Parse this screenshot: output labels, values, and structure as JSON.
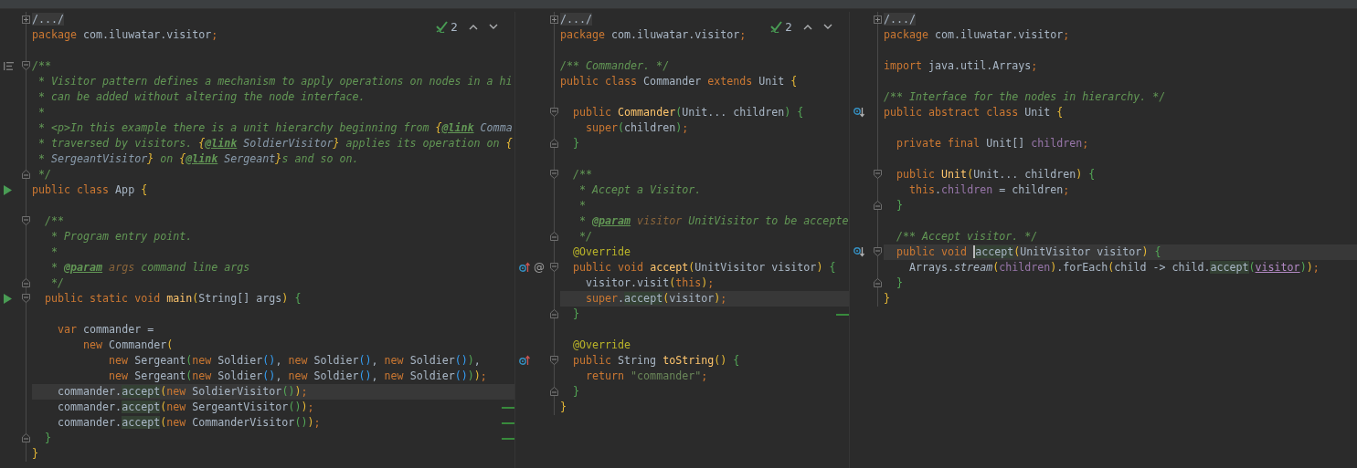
{
  "panes": [
    {
      "inspection": {
        "count": "2"
      },
      "lines": [
        {
          "kind": "code",
          "fold": {
            "kind": "plus"
          },
          "current": false,
          "changed": false,
          "tokens": [
            {
              "kind": "folded",
              "text": "/.../"
            }
          ]
        },
        {
          "kind": "code",
          "current": false,
          "changed": false,
          "tokens": [
            {
              "kind": "kw",
              "text": "package "
            },
            {
              "kind": "plain",
              "text": "com.iluwatar.visitor"
            },
            {
              "kind": "kw",
              "text": ";"
            }
          ]
        },
        {
          "kind": "blank"
        },
        {
          "kind": "code",
          "marker": {
            "kind": "docs"
          },
          "fold": {
            "kind": "open"
          },
          "current": false,
          "changed": false,
          "tokens": [
            {
              "kind": "comment",
              "text": "/**"
            }
          ]
        },
        {
          "kind": "code",
          "current": false,
          "changed": false,
          "tokens": [
            {
              "kind": "comment",
              "text": " * Visitor pattern defines a mechanism to apply operations on nodes in a hi"
            }
          ]
        },
        {
          "kind": "code",
          "current": false,
          "changed": false,
          "tokens": [
            {
              "kind": "comment",
              "text": " * can be added without altering the node interface."
            }
          ]
        },
        {
          "kind": "code",
          "current": false,
          "changed": false,
          "tokens": [
            {
              "kind": "comment",
              "text": " *"
            }
          ]
        },
        {
          "kind": "code",
          "current": false,
          "changed": false,
          "tokens": [
            {
              "kind": "comment",
              "text": " * <p>In this example there is a unit hierarchy beginning from "
            },
            {
              "kind": "docbrace",
              "text": "{"
            },
            {
              "kind": "doctag",
              "text": "@link"
            },
            {
              "kind": "docref",
              "text": " Comma"
            }
          ]
        },
        {
          "kind": "code",
          "current": false,
          "changed": false,
          "tokens": [
            {
              "kind": "comment",
              "text": " * traversed by visitors. "
            },
            {
              "kind": "docbrace",
              "text": "{"
            },
            {
              "kind": "doctag",
              "text": "@link"
            },
            {
              "kind": "docref",
              "text": " SoldierVisitor"
            },
            {
              "kind": "docbrace",
              "text": "}"
            },
            {
              "kind": "comment",
              "text": " applies its operation on "
            },
            {
              "kind": "docbrace",
              "text": "{"
            }
          ]
        },
        {
          "kind": "code",
          "current": false,
          "changed": false,
          "tokens": [
            {
              "kind": "comment",
              "text": " * "
            },
            {
              "kind": "docref",
              "text": "SergeantVisitor"
            },
            {
              "kind": "docbrace",
              "text": "}"
            },
            {
              "kind": "comment",
              "text": " on "
            },
            {
              "kind": "docbrace",
              "text": "{"
            },
            {
              "kind": "doctag",
              "text": "@link"
            },
            {
              "kind": "docref",
              "text": " Sergeant"
            },
            {
              "kind": "docbrace",
              "text": "}"
            },
            {
              "kind": "comment",
              "text": "s and so on."
            }
          ]
        },
        {
          "kind": "code",
          "fold": {
            "kind": "close"
          },
          "current": false,
          "changed": false,
          "tokens": [
            {
              "kind": "comment",
              "text": " */"
            }
          ]
        },
        {
          "kind": "code",
          "marker": {
            "kind": "run"
          },
          "current": false,
          "changed": false,
          "tokens": [
            {
              "kind": "kw",
              "text": "public class "
            },
            {
              "kind": "plain",
              "text": "App "
            },
            {
              "kind": "b1",
              "text": "{"
            }
          ]
        },
        {
          "kind": "blank"
        },
        {
          "kind": "code",
          "fold": {
            "kind": "open"
          },
          "current": false,
          "changed": false,
          "tokens": [
            {
              "kind": "comment",
              "text": "  /**"
            }
          ]
        },
        {
          "kind": "code",
          "current": false,
          "changed": false,
          "tokens": [
            {
              "kind": "comment",
              "text": "   * Program entry point."
            }
          ]
        },
        {
          "kind": "code",
          "current": false,
          "changed": false,
          "tokens": [
            {
              "kind": "comment",
              "text": "   *"
            }
          ]
        },
        {
          "kind": "code",
          "current": false,
          "changed": false,
          "tokens": [
            {
              "kind": "comment",
              "text": "   * "
            },
            {
              "kind": "doctag",
              "text": "@param"
            },
            {
              "kind": "docparam",
              "text": " args"
            },
            {
              "kind": "comment",
              "text": " command line args"
            }
          ]
        },
        {
          "kind": "code",
          "fold": {
            "kind": "close"
          },
          "current": false,
          "changed": false,
          "tokens": [
            {
              "kind": "comment",
              "text": "   */"
            }
          ]
        },
        {
          "kind": "code",
          "marker": {
            "kind": "run"
          },
          "fold": {
            "kind": "open"
          },
          "current": false,
          "changed": false,
          "tokens": [
            {
              "kind": "kw",
              "text": "  public static void "
            },
            {
              "kind": "method",
              "text": "main"
            },
            {
              "kind": "b1",
              "text": "("
            },
            {
              "kind": "plain",
              "text": "String[] args"
            },
            {
              "kind": "b1",
              "text": ") "
            },
            {
              "kind": "b2",
              "text": "{"
            }
          ]
        },
        {
          "kind": "blank"
        },
        {
          "kind": "code",
          "current": false,
          "changed": false,
          "tokens": [
            {
              "kind": "kw",
              "text": "    var "
            },
            {
              "kind": "plain",
              "text": "commander ="
            }
          ]
        },
        {
          "kind": "code",
          "current": false,
          "changed": false,
          "tokens": [
            {
              "kind": "kw",
              "text": "        new "
            },
            {
              "kind": "plain",
              "text": "Commander"
            },
            {
              "kind": "b1",
              "text": "("
            }
          ]
        },
        {
          "kind": "code",
          "current": false,
          "changed": false,
          "tokens": [
            {
              "kind": "kw",
              "text": "            new "
            },
            {
              "kind": "plain",
              "text": "Sergeant"
            },
            {
              "kind": "b2",
              "text": "("
            },
            {
              "kind": "kw",
              "text": "new "
            },
            {
              "kind": "plain",
              "text": "Soldier"
            },
            {
              "kind": "b3",
              "text": "()"
            },
            {
              "kind": "plain",
              "text": ", "
            },
            {
              "kind": "kw",
              "text": "new "
            },
            {
              "kind": "plain",
              "text": "Soldier"
            },
            {
              "kind": "b3",
              "text": "()"
            },
            {
              "kind": "plain",
              "text": ", "
            },
            {
              "kind": "kw",
              "text": "new "
            },
            {
              "kind": "plain",
              "text": "Soldier"
            },
            {
              "kind": "b3",
              "text": "()"
            },
            {
              "kind": "b2",
              "text": ")"
            },
            {
              "kind": "plain",
              "text": ","
            }
          ]
        },
        {
          "kind": "code",
          "current": false,
          "changed": false,
          "tokens": [
            {
              "kind": "kw",
              "text": "            new "
            },
            {
              "kind": "plain",
              "text": "Sergeant"
            },
            {
              "kind": "b2",
              "text": "("
            },
            {
              "kind": "kw",
              "text": "new "
            },
            {
              "kind": "plain",
              "text": "Soldier"
            },
            {
              "kind": "b3",
              "text": "()"
            },
            {
              "kind": "plain",
              "text": ", "
            },
            {
              "kind": "kw",
              "text": "new "
            },
            {
              "kind": "plain",
              "text": "Soldier"
            },
            {
              "kind": "b3",
              "text": "()"
            },
            {
              "kind": "plain",
              "text": ", "
            },
            {
              "kind": "kw",
              "text": "new "
            },
            {
              "kind": "plain",
              "text": "Soldier"
            },
            {
              "kind": "b3",
              "text": "()"
            },
            {
              "kind": "b2",
              "text": ")"
            },
            {
              "kind": "b1",
              "text": ")"
            },
            {
              "kind": "kw",
              "text": ";"
            }
          ]
        },
        {
          "kind": "code",
          "current": true,
          "changed": false,
          "tokens": [
            {
              "kind": "plain",
              "text": "    commander."
            },
            {
              "kind": "usage",
              "text": "accept"
            },
            {
              "kind": "b1",
              "text": "("
            },
            {
              "kind": "kw",
              "text": "new "
            },
            {
              "kind": "plain",
              "text": "SoldierVisitor"
            },
            {
              "kind": "b2",
              "text": "()"
            },
            {
              "kind": "b1",
              "text": ")"
            },
            {
              "kind": "kw",
              "text": ";"
            }
          ]
        },
        {
          "kind": "code",
          "current": false,
          "changed": true,
          "tokens": [
            {
              "kind": "plain",
              "text": "    commander."
            },
            {
              "kind": "usage",
              "text": "accept"
            },
            {
              "kind": "b1",
              "text": "("
            },
            {
              "kind": "kw",
              "text": "new "
            },
            {
              "kind": "plain",
              "text": "SergeantVisitor"
            },
            {
              "kind": "b2",
              "text": "()"
            },
            {
              "kind": "b1",
              "text": ")"
            },
            {
              "kind": "kw",
              "text": ";"
            }
          ]
        },
        {
          "kind": "code",
          "current": false,
          "changed": true,
          "tokens": [
            {
              "kind": "plain",
              "text": "    commander."
            },
            {
              "kind": "usage",
              "text": "accept"
            },
            {
              "kind": "b1",
              "text": "("
            },
            {
              "kind": "kw",
              "text": "new "
            },
            {
              "kind": "plain",
              "text": "CommanderVisitor"
            },
            {
              "kind": "b2",
              "text": "()"
            },
            {
              "kind": "b1",
              "text": ")"
            },
            {
              "kind": "kw",
              "text": ";"
            }
          ]
        },
        {
          "kind": "code",
          "fold": {
            "kind": "close"
          },
          "current": false,
          "changed": true,
          "tokens": [
            {
              "kind": "b2",
              "text": "  }"
            }
          ]
        },
        {
          "kind": "code",
          "current": false,
          "changed": false,
          "tokens": [
            {
              "kind": "b1",
              "text": "}"
            }
          ]
        }
      ]
    },
    {
      "inspection": {
        "count": "2"
      },
      "lines": [
        {
          "kind": "code",
          "fold": {
            "kind": "plus"
          },
          "current": false,
          "changed": false,
          "tokens": [
            {
              "kind": "folded",
              "text": "/.../"
            }
          ]
        },
        {
          "kind": "code",
          "current": false,
          "changed": false,
          "tokens": [
            {
              "kind": "kw",
              "text": "package "
            },
            {
              "kind": "plain",
              "text": "com.iluwatar.visitor"
            },
            {
              "kind": "kw",
              "text": ";"
            }
          ]
        },
        {
          "kind": "blank"
        },
        {
          "kind": "code",
          "current": false,
          "changed": false,
          "tokens": [
            {
              "kind": "comment",
              "text": "/** Commander. */"
            }
          ]
        },
        {
          "kind": "code",
          "current": false,
          "changed": false,
          "tokens": [
            {
              "kind": "kw",
              "text": "public class "
            },
            {
              "kind": "plain",
              "text": "Commander "
            },
            {
              "kind": "kw",
              "text": "extends "
            },
            {
              "kind": "plain",
              "text": "Unit "
            },
            {
              "kind": "b1",
              "text": "{"
            }
          ]
        },
        {
          "kind": "blank"
        },
        {
          "kind": "code",
          "fold": {
            "kind": "open"
          },
          "current": false,
          "changed": false,
          "tokens": [
            {
              "kind": "kw",
              "text": "  public "
            },
            {
              "kind": "method",
              "text": "Commander"
            },
            {
              "kind": "b2",
              "text": "("
            },
            {
              "kind": "plain",
              "text": "Unit... children"
            },
            {
              "kind": "b2",
              "text": ") "
            },
            {
              "kind": "b2",
              "text": "{"
            }
          ]
        },
        {
          "kind": "code",
          "current": false,
          "changed": false,
          "tokens": [
            {
              "kind": "kw",
              "text": "    super"
            },
            {
              "kind": "b2",
              "text": "("
            },
            {
              "kind": "plain",
              "text": "children"
            },
            {
              "kind": "b2",
              "text": ")"
            },
            {
              "kind": "kw",
              "text": ";"
            }
          ]
        },
        {
          "kind": "code",
          "fold": {
            "kind": "close"
          },
          "current": false,
          "changed": false,
          "tokens": [
            {
              "kind": "b2",
              "text": "  }"
            }
          ]
        },
        {
          "kind": "blank"
        },
        {
          "kind": "code",
          "fold": {
            "kind": "open"
          },
          "current": false,
          "changed": false,
          "tokens": [
            {
              "kind": "comment",
              "text": "  /**"
            }
          ]
        },
        {
          "kind": "code",
          "current": false,
          "changed": false,
          "tokens": [
            {
              "kind": "comment",
              "text": "   * Accept a Visitor."
            }
          ]
        },
        {
          "kind": "code",
          "current": false,
          "changed": false,
          "tokens": [
            {
              "kind": "comment",
              "text": "   *"
            }
          ]
        },
        {
          "kind": "code",
          "current": false,
          "changed": false,
          "tokens": [
            {
              "kind": "comment",
              "text": "   * "
            },
            {
              "kind": "doctag",
              "text": "@param"
            },
            {
              "kind": "docparam",
              "text": " visitor"
            },
            {
              "kind": "comment",
              "text": " UnitVisitor to be accepte"
            }
          ]
        },
        {
          "kind": "code",
          "fold": {
            "kind": "close"
          },
          "current": false,
          "changed": false,
          "tokens": [
            {
              "kind": "comment",
              "text": "   */"
            }
          ]
        },
        {
          "kind": "code",
          "current": false,
          "changed": false,
          "tokens": [
            {
              "kind": "ann",
              "text": "  @Override"
            }
          ]
        },
        {
          "kind": "code",
          "marker": {
            "kind": "overrides"
          },
          "gutter_text": "@",
          "fold": {
            "kind": "open"
          },
          "current": false,
          "changed": false,
          "tokens": [
            {
              "kind": "kw",
              "text": "  public void "
            },
            {
              "kind": "method",
              "text": "accept"
            },
            {
              "kind": "b1",
              "text": "("
            },
            {
              "kind": "plain",
              "text": "UnitVisitor visitor"
            },
            {
              "kind": "b1",
              "text": ") "
            },
            {
              "kind": "b2",
              "text": "{"
            }
          ]
        },
        {
          "kind": "code",
          "current": false,
          "changed": false,
          "tokens": [
            {
              "kind": "plain",
              "text": "    visitor.visit"
            },
            {
              "kind": "b1",
              "text": "("
            },
            {
              "kind": "kw",
              "text": "this"
            },
            {
              "kind": "b1",
              "text": ")"
            },
            {
              "kind": "kw",
              "text": ";"
            }
          ]
        },
        {
          "kind": "code",
          "current": true,
          "changed": false,
          "tokens": [
            {
              "kind": "kw",
              "text": "    super"
            },
            {
              "kind": "plain",
              "text": "."
            },
            {
              "kind": "usage",
              "text": "accept"
            },
            {
              "kind": "b1",
              "text": "("
            },
            {
              "kind": "plain",
              "text": "visitor"
            },
            {
              "kind": "b1",
              "text": ")"
            },
            {
              "kind": "kw",
              "text": ";"
            }
          ]
        },
        {
          "kind": "code",
          "fold": {
            "kind": "close"
          },
          "current": false,
          "changed": true,
          "tokens": [
            {
              "kind": "b2",
              "text": "  }"
            }
          ]
        },
        {
          "kind": "blank"
        },
        {
          "kind": "code",
          "current": false,
          "changed": false,
          "tokens": [
            {
              "kind": "ann",
              "text": "  @Override"
            }
          ]
        },
        {
          "kind": "code",
          "marker": {
            "kind": "overrides"
          },
          "fold": {
            "kind": "open"
          },
          "current": false,
          "changed": false,
          "tokens": [
            {
              "kind": "kw",
              "text": "  public "
            },
            {
              "kind": "plain",
              "text": "String "
            },
            {
              "kind": "method",
              "text": "toString"
            },
            {
              "kind": "b1",
              "text": "() "
            },
            {
              "kind": "b2",
              "text": "{"
            }
          ]
        },
        {
          "kind": "code",
          "current": false,
          "changed": false,
          "tokens": [
            {
              "kind": "kw",
              "text": "    return "
            },
            {
              "kind": "string",
              "text": "\"commander\""
            },
            {
              "kind": "kw",
              "text": ";"
            }
          ]
        },
        {
          "kind": "code",
          "fold": {
            "kind": "close"
          },
          "current": false,
          "changed": false,
          "tokens": [
            {
              "kind": "b2",
              "text": "  }"
            }
          ]
        },
        {
          "kind": "code",
          "current": false,
          "changed": false,
          "tokens": [
            {
              "kind": "b1",
              "text": "}"
            }
          ]
        }
      ]
    },
    {
      "lines": [
        {
          "kind": "code",
          "fold": {
            "kind": "plus"
          },
          "current": false,
          "changed": false,
          "tokens": [
            {
              "kind": "folded",
              "text": "/.../"
            }
          ]
        },
        {
          "kind": "code",
          "current": false,
          "changed": false,
          "tokens": [
            {
              "kind": "kw",
              "text": "package "
            },
            {
              "kind": "plain",
              "text": "com.iluwatar.visitor"
            },
            {
              "kind": "kw",
              "text": ";"
            }
          ]
        },
        {
          "kind": "blank"
        },
        {
          "kind": "code",
          "current": false,
          "changed": false,
          "tokens": [
            {
              "kind": "kw",
              "text": "import "
            },
            {
              "kind": "plain",
              "text": "java.util.Arrays"
            },
            {
              "kind": "kw",
              "text": ";"
            }
          ]
        },
        {
          "kind": "blank"
        },
        {
          "kind": "code",
          "current": false,
          "changed": false,
          "tokens": [
            {
              "kind": "comment",
              "text": "/** Interface for the nodes in hierarchy. */"
            }
          ]
        },
        {
          "kind": "code",
          "marker": {
            "kind": "implemented"
          },
          "current": false,
          "changed": false,
          "tokens": [
            {
              "kind": "kw",
              "text": "public abstract class "
            },
            {
              "kind": "plain",
              "text": "Unit "
            },
            {
              "kind": "b1",
              "text": "{"
            }
          ]
        },
        {
          "kind": "blank"
        },
        {
          "kind": "code",
          "current": false,
          "changed": false,
          "tokens": [
            {
              "kind": "kw",
              "text": "  private final "
            },
            {
              "kind": "plain",
              "text": "Unit[] "
            },
            {
              "kind": "field",
              "text": "children"
            },
            {
              "kind": "kw",
              "text": ";"
            }
          ]
        },
        {
          "kind": "blank"
        },
        {
          "kind": "code",
          "fold": {
            "kind": "open"
          },
          "current": false,
          "changed": false,
          "tokens": [
            {
              "kind": "kw",
              "text": "  public "
            },
            {
              "kind": "method",
              "text": "Unit"
            },
            {
              "kind": "b1",
              "text": "("
            },
            {
              "kind": "plain",
              "text": "Unit... children"
            },
            {
              "kind": "b1",
              "text": ") "
            },
            {
              "kind": "b2",
              "text": "{"
            }
          ]
        },
        {
          "kind": "code",
          "current": false,
          "changed": false,
          "tokens": [
            {
              "kind": "kw",
              "text": "    this"
            },
            {
              "kind": "plain",
              "text": "."
            },
            {
              "kind": "field",
              "text": "children"
            },
            {
              "kind": "plain",
              "text": " = children"
            },
            {
              "kind": "kw",
              "text": ";"
            }
          ]
        },
        {
          "kind": "code",
          "fold": {
            "kind": "close"
          },
          "current": false,
          "changed": false,
          "tokens": [
            {
              "kind": "b2",
              "text": "  }"
            }
          ]
        },
        {
          "kind": "blank"
        },
        {
          "kind": "code",
          "current": false,
          "changed": false,
          "tokens": [
            {
              "kind": "comment",
              "text": "  /** Accept visitor. */"
            }
          ]
        },
        {
          "kind": "code",
          "marker": {
            "kind": "implemented"
          },
          "fold": {
            "kind": "open"
          },
          "current": true,
          "changed": false,
          "tokens": [
            {
              "kind": "kw",
              "text": "  public void "
            },
            {
              "kind": "caret-usage",
              "text": "accept"
            },
            {
              "kind": "b1",
              "text": "("
            },
            {
              "kind": "plain",
              "text": "UnitVisitor visitor"
            },
            {
              "kind": "b1",
              "text": ") "
            },
            {
              "kind": "b2",
              "text": "{"
            }
          ]
        },
        {
          "kind": "code",
          "current": false,
          "changed": false,
          "tokens": [
            {
              "kind": "plain",
              "text": "    Arrays."
            },
            {
              "kind": "static",
              "text": "stream"
            },
            {
              "kind": "b1",
              "text": "("
            },
            {
              "kind": "field",
              "text": "children"
            },
            {
              "kind": "b1",
              "text": ")"
            },
            {
              "kind": "plain",
              "text": ".forEach"
            },
            {
              "kind": "b1",
              "text": "("
            },
            {
              "kind": "plain",
              "text": "child -> child."
            },
            {
              "kind": "usage",
              "text": "accept"
            },
            {
              "kind": "b2",
              "text": "("
            },
            {
              "kind": "paramref",
              "text": "visitor"
            },
            {
              "kind": "b2",
              "text": ")"
            },
            {
              "kind": "b1",
              "text": ")"
            },
            {
              "kind": "kw",
              "text": ";"
            }
          ]
        },
        {
          "kind": "code",
          "fold": {
            "kind": "close"
          },
          "current": false,
          "changed": false,
          "tokens": [
            {
              "kind": "b2",
              "text": "  }"
            }
          ]
        },
        {
          "kind": "code",
          "current": false,
          "changed": false,
          "tokens": [
            {
              "kind": "b1",
              "text": "}"
            }
          ]
        }
      ]
    }
  ]
}
